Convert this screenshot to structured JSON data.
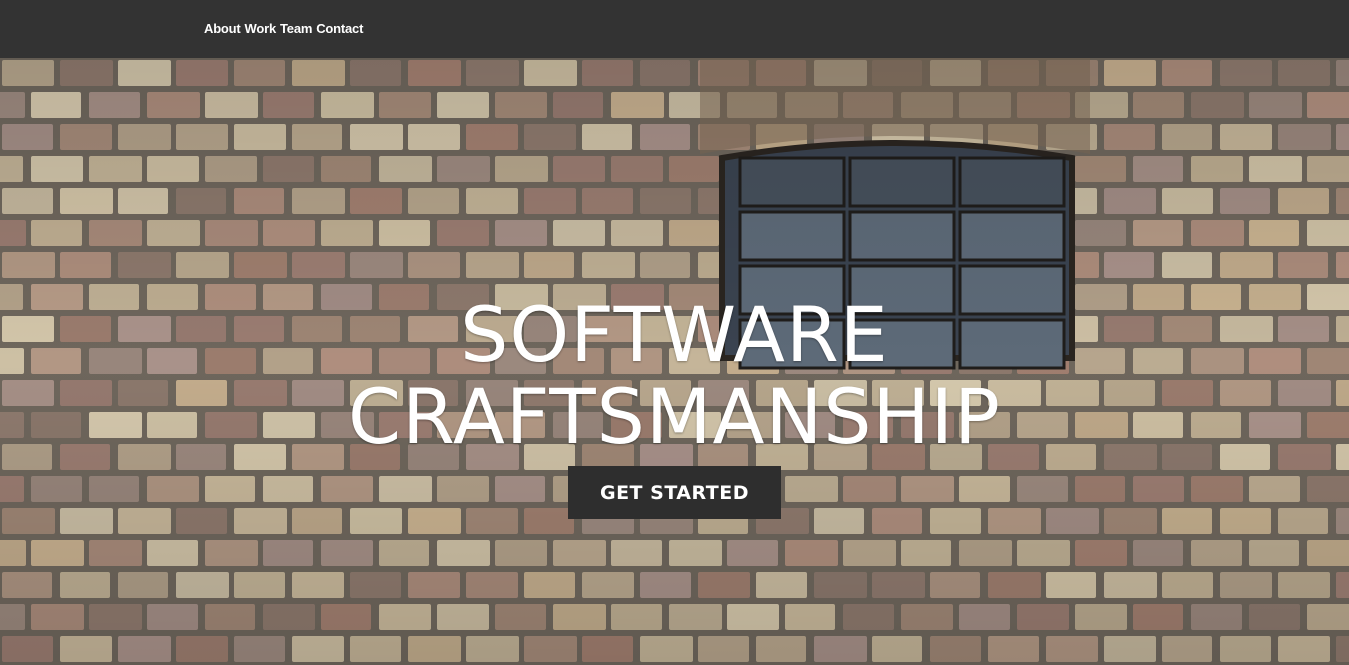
{
  "nav": {
    "links": [
      {
        "label": "About"
      },
      {
        "label": "Work"
      },
      {
        "label": "Team"
      },
      {
        "label": "Contact"
      }
    ]
  },
  "hero": {
    "headline_line1": "SOFTWARE",
    "headline_line2": "CRAFTSMANSHIP",
    "cta_label": "GET STARTED",
    "background": "brick-wall-with-barred-window-photo"
  },
  "colors": {
    "navbar": "#333333",
    "button": "#2e2e2e",
    "text": "#ffffff"
  }
}
